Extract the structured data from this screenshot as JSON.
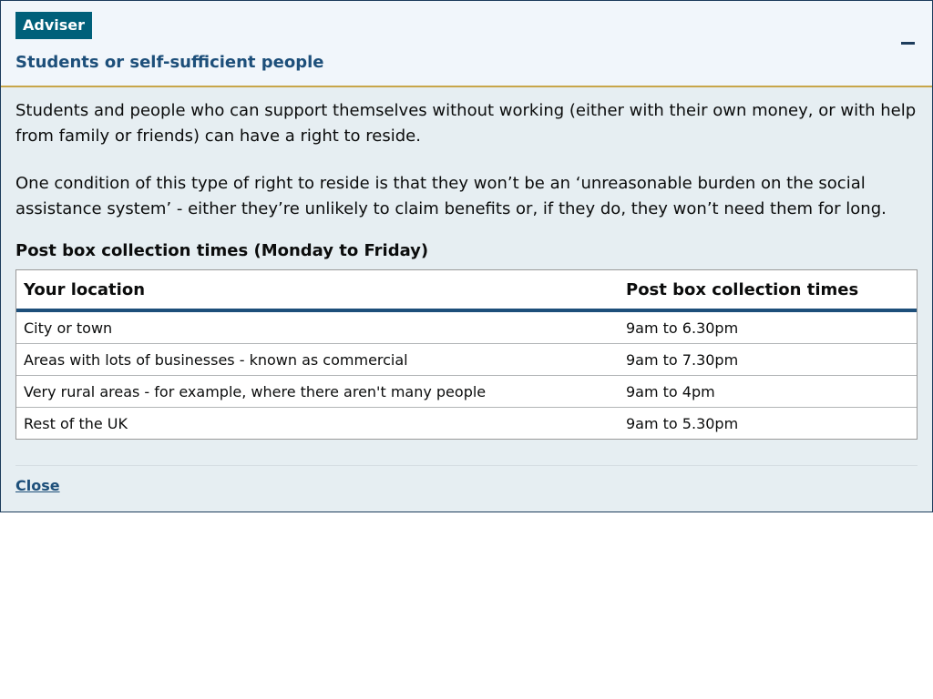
{
  "panel": {
    "tag": "Adviser",
    "title": "Students or self-sufficient people",
    "collapse_icon": "minus-icon"
  },
  "body": {
    "paragraphs": [
      "Students and people who can support themselves without working (either with their own money, or with help from family or friends) can have a right to reside.",
      "One condition of this type of right to reside is that they won’t be an ‘unreasonable burden on the social assistance system’ - either they’re unlikely to claim benefits or, if they do, they won’t need them for long."
    ],
    "table": {
      "caption": "Post box collection times (Monday to Friday)",
      "headers": [
        "Your location",
        "Post box collection times"
      ],
      "rows": [
        [
          "City or town",
          "9am to 6.30pm"
        ],
        [
          "Areas with lots of businesses - known as commercial",
          "9am to 7.30pm"
        ],
        [
          "Very rural areas - for example, where there aren't many people",
          "9am to 4pm"
        ],
        [
          "Rest of the UK",
          "9am to 5.30pm"
        ]
      ]
    },
    "close_label": "Close"
  },
  "colors": {
    "tag_bg": "#00607a",
    "title": "#1d4f7a",
    "header_rule": "#c8a64a",
    "panel_bg": "#e6eef2"
  }
}
